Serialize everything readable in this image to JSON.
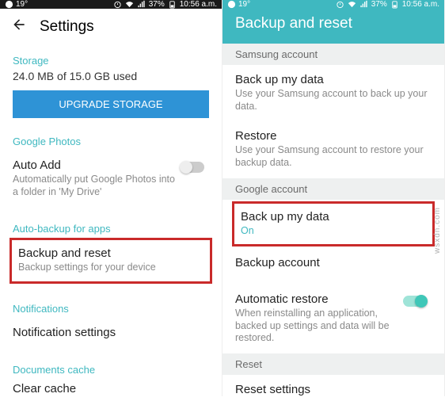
{
  "status": {
    "time": "10:56 a.m.",
    "battery": "37%",
    "temp": "19°"
  },
  "left": {
    "header_title": "Settings",
    "storage_header": "Storage",
    "storage_text": "24.0 MB of 15.0 GB used",
    "upgrade_btn": "UPGRADE STORAGE",
    "gphotos_header": "Google Photos",
    "autoadd_title": "Auto Add",
    "autoadd_sub": "Automatically put Google Photos into a folder in 'My Drive'",
    "autobackup_header": "Auto-backup for apps",
    "backup_reset_title": "Backup and reset",
    "backup_reset_sub": "Backup settings for your device",
    "notifications_header": "Notifications",
    "notif_settings_title": "Notification settings",
    "doc_cache_header": "Documents cache",
    "clear_cache_title": "Clear cache"
  },
  "right": {
    "header_title": "Backup and reset",
    "samsung_header": "Samsung account",
    "backup_data_title": "Back up my data",
    "backup_data_sub": "Use your Samsung account to back up your data.",
    "restore_title": "Restore",
    "restore_sub": "Use your Samsung account to restore your backup data.",
    "google_header": "Google account",
    "g_backup_title": "Back up my data",
    "g_backup_sub": "On",
    "backup_account_title": "Backup account",
    "auto_restore_title": "Automatic restore",
    "auto_restore_sub": "When reinstalling an application, backed up settings and data will be restored.",
    "reset_header": "Reset",
    "reset_settings_title": "Reset settings"
  },
  "watermark": "wsxdn.com"
}
